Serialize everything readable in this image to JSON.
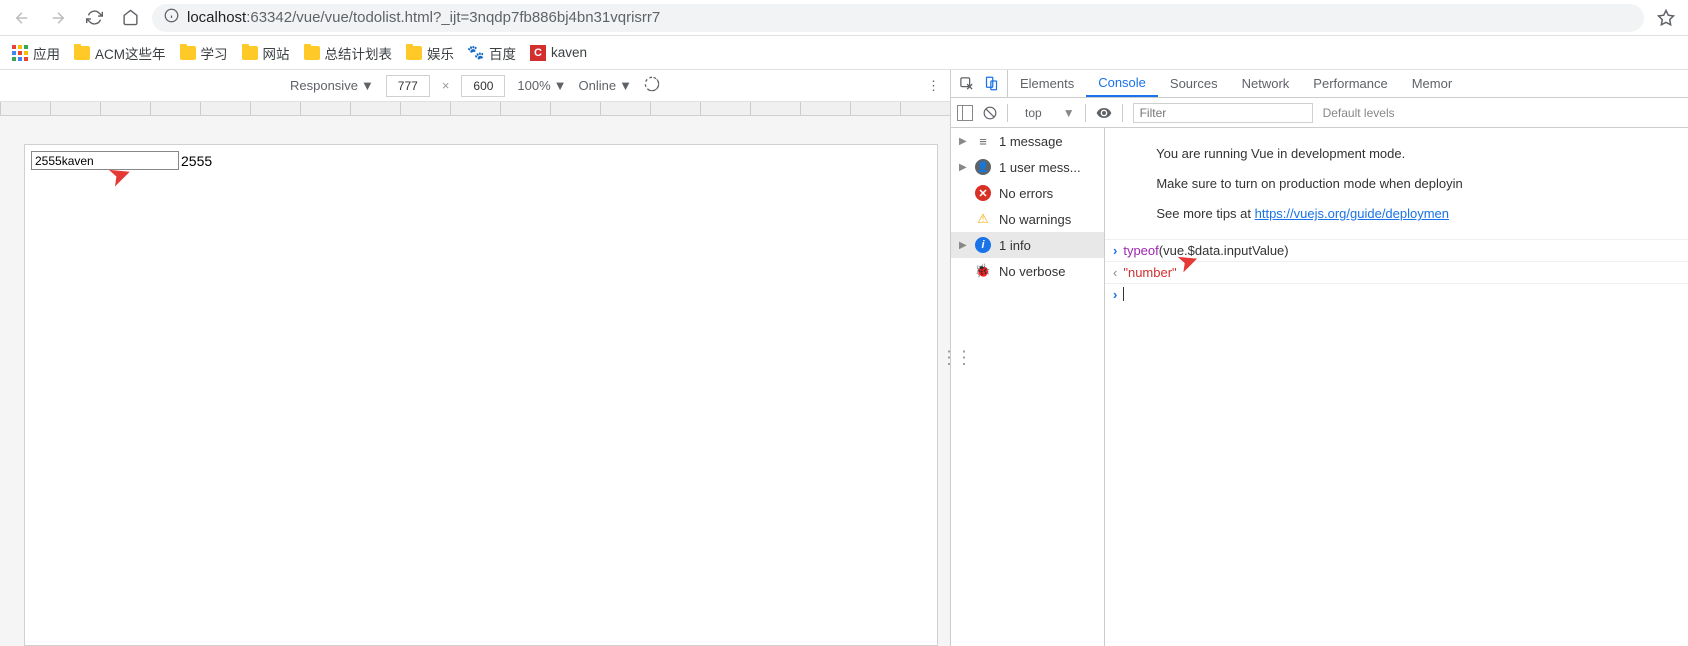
{
  "browser": {
    "url_host": "localhost",
    "url_port_path": ":63342/vue/vue/todolist.html?_ijt=3nqdp7fb886bj4bn31vqrisrr7"
  },
  "bookmarks": {
    "apps": "应用",
    "items": [
      {
        "label": "ACM这些年"
      },
      {
        "label": "学习"
      },
      {
        "label": "网站"
      },
      {
        "label": "总结计划表"
      },
      {
        "label": "娱乐"
      }
    ],
    "baidu": "百度",
    "kaven": "kaven"
  },
  "device_toolbar": {
    "device": "Responsive",
    "width": "777",
    "height": "600",
    "zoom": "100%",
    "network": "Online"
  },
  "page": {
    "input_value": "2555kaven",
    "output_value": "2555"
  },
  "devtools": {
    "tabs": [
      "Elements",
      "Console",
      "Sources",
      "Network",
      "Performance",
      "Memor"
    ],
    "active_tab": "Console",
    "context": "top",
    "filter_placeholder": "Filter",
    "levels": "Default levels",
    "sidebar": [
      {
        "icon": "msg",
        "label": "1 message",
        "expandable": true
      },
      {
        "icon": "user",
        "label": "1 user mess...",
        "expandable": true
      },
      {
        "icon": "err",
        "label": "No errors",
        "expandable": false
      },
      {
        "icon": "warn",
        "label": "No warnings",
        "expandable": false
      },
      {
        "icon": "info",
        "label": "1 info",
        "expandable": true,
        "selected": true
      },
      {
        "icon": "bug",
        "label": "No verbose",
        "expandable": false
      }
    ],
    "console": {
      "msg1": "You are running Vue in development mode.",
      "msg2": "Make sure to turn on production mode when deployin",
      "msg3_prefix": "See more tips at ",
      "msg3_link": "https://vuejs.org/guide/deploymen",
      "cmd_fn": "typeof",
      "cmd_args": "(vue.$data.inputValue)",
      "result": "\"number\""
    }
  }
}
